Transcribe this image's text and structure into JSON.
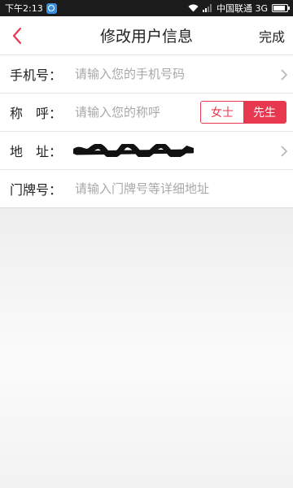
{
  "status_bar": {
    "time": "下午2:13",
    "carrier": "中国联通 3G",
    "battery_level": 0.9
  },
  "header": {
    "title": "修改用户信息",
    "done_label": "完成",
    "back_icon": "chevron-left-icon",
    "accent_color": "#e8384f"
  },
  "form": {
    "phone": {
      "label": "手机号：",
      "placeholder": "请输入您的手机号码",
      "value": ""
    },
    "nickname": {
      "label": "称　呼：",
      "placeholder": "请输入您的称呼",
      "value": "",
      "gender_options": [
        "女士",
        "先生"
      ],
      "selected_gender": "先生"
    },
    "address": {
      "label": "地　址："
    },
    "house_number": {
      "label": "门牌号：",
      "placeholder": "请输入门牌号等详细地址",
      "value": ""
    }
  }
}
